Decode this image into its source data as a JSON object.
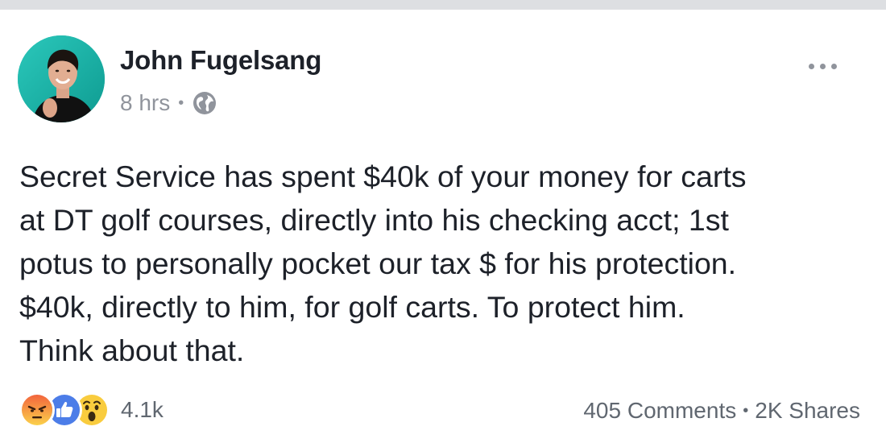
{
  "post": {
    "author": "John Fugelsang",
    "timestamp": "8 hrs",
    "separator": "•",
    "privacy_icon": "globe-icon",
    "text_lines": [
      "Secret Service has spent $40k of your money for carts",
      "at DT golf courses, directly into his checking acct; 1st",
      "potus to personally pocket our tax $ for his protection.",
      "$40k, directly to him, for golf carts. To protect him.",
      "Think about that."
    ]
  },
  "reactions": {
    "icons": [
      "angry-reaction-icon",
      "like-reaction-icon",
      "wow-reaction-icon"
    ],
    "count": "4.1k"
  },
  "engagement": {
    "comments": "405 Comments",
    "separator": "•",
    "shares": "2K Shares"
  },
  "colors": {
    "author_text": "#1d2129",
    "meta_text": "#90949c",
    "like_blue": "#4c7de8",
    "reaction_yellow": "#f9cc3e",
    "angry_orange": "#f27040",
    "avatar_bg": "#18b3a7"
  }
}
